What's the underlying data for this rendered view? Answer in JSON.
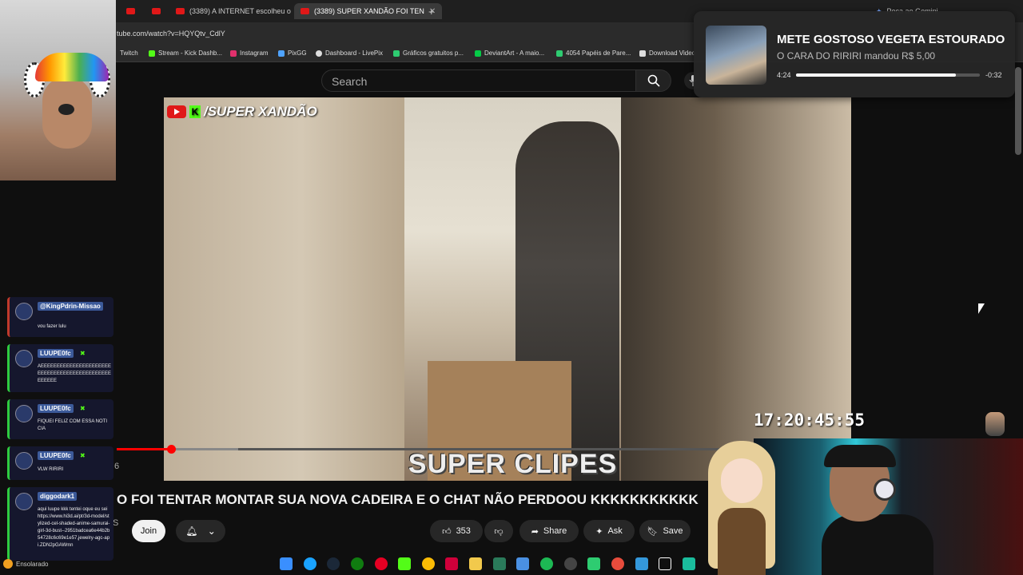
{
  "browser": {
    "tabs": [
      {
        "label": ""
      },
      {
        "label": ""
      },
      {
        "label": "(3389) A INTERNET escolheu o"
      },
      {
        "label": "(3389) SUPER XANDÃO FOI TEN"
      }
    ],
    "url": "tube.com/watch?v=HQYQtv_CdlY",
    "gemini": "Peça ao Gemini",
    "bookmarks": [
      {
        "label": "Twitch",
        "color": "#9146ff"
      },
      {
        "label": "Stream - Kick Dashb...",
        "color": "#53fc18"
      },
      {
        "label": "Instagram",
        "color": "#e1306c"
      },
      {
        "label": "PixGG",
        "color": "#4fa3ff"
      },
      {
        "label": "Dashboard - LivePix",
        "color": "#dddddd"
      },
      {
        "label": "Gráficos gratuitos p...",
        "color": "#2ecc71"
      },
      {
        "label": "DeviantArt - A maio...",
        "color": "#05cc47"
      },
      {
        "label": "4054 Papéis de Pare...",
        "color": "#2ecc71"
      },
      {
        "label": "Download Video",
        "color": "#dddddd"
      }
    ]
  },
  "youtube": {
    "search_placeholder": "Search",
    "video": {
      "watermark": "/SUPER XANDÃO",
      "kick_letter": "K",
      "overlay_text": "SUPER CLIPES",
      "progress": 0.09,
      "buffered": 0.2
    },
    "title": "O FOI TENTAR MONTAR SUA NOVA CADEIRA E O CHAT NÃO PERDOOU KKKKKKKKKKK",
    "sub_count_fragment": "6",
    "sub_count_fragment2": "S",
    "join_label": "Join",
    "likes": "353",
    "share_label": "Share",
    "ask_label": "Ask",
    "save_label": "Save"
  },
  "clock": "17:20:45:55",
  "now_playing": {
    "title": "METE GOSTOSO VEGETA ESTOURADO",
    "subtitle": "O CARA DO RIRIRI mandou R$ 5,00",
    "elapsed": "4:24",
    "remaining": "-0:32",
    "progress": 0.87
  },
  "chat": [
    {
      "user": "@KingPdrin-Missao",
      "message": "vou fazer lulu",
      "accent": "#c0392b"
    },
    {
      "user": "LUUPE0fc",
      "message": "AEEEEEEEEEEEEEEEEEEEEEEEEEEEEEEEEEEEEEEEEEEEEEEEEEEE",
      "accent": "#2ecc40"
    },
    {
      "user": "LUUPE0fc",
      "message": "FIQUEI FELIZ COM ESSA NOTICIA",
      "accent": "#2ecc40"
    },
    {
      "user": "LUUPE0fc",
      "message": "VLW RIRIRI",
      "accent": "#2ecc40"
    },
    {
      "user": "diggodark1",
      "message": "aqui luupe kkk tentei oque eu sei https://www.hi3d.ai/pt/3d-model/stylized-cel-shaded-anime-samurai-girl-3d-bust--2951badcea6e44b2b54728c6c69e1e57,jewelry-agc-api.ZDN2pGAWmn",
      "accent": "#2ecc40"
    }
  ],
  "weather": "Ensolarado"
}
